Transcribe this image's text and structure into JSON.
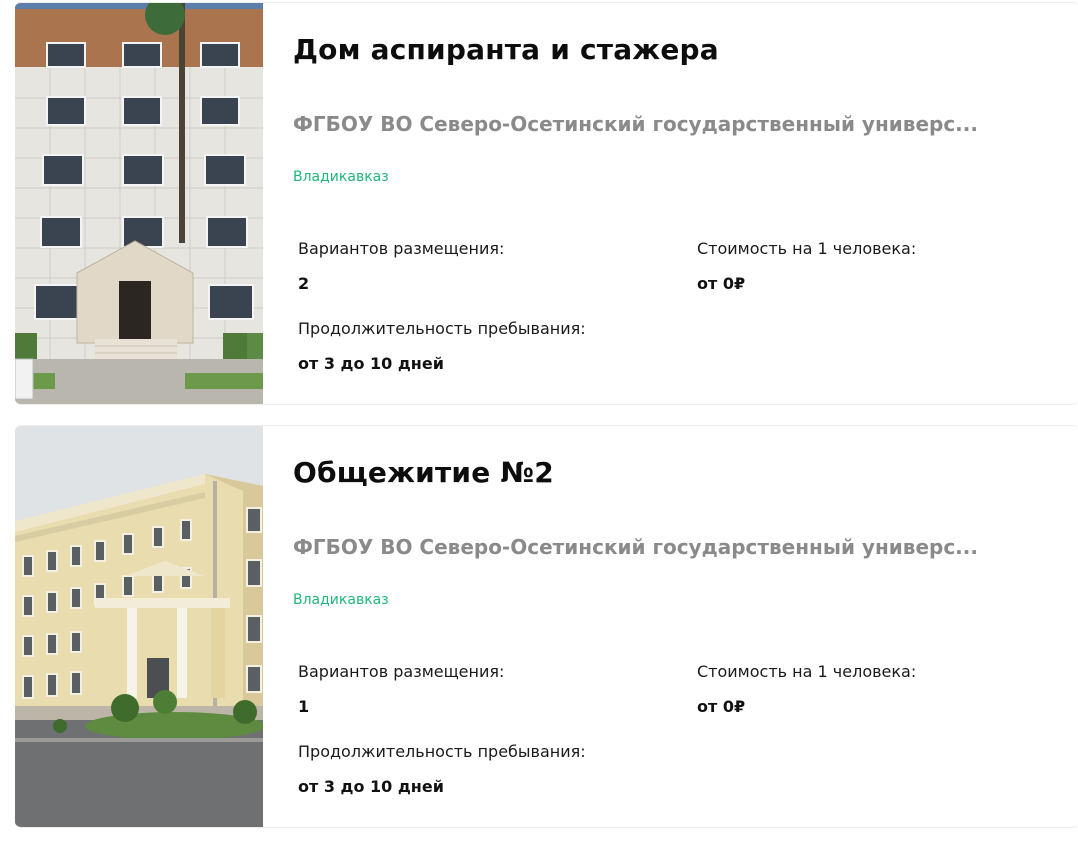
{
  "cards": [
    {
      "title": "Дом аспиранта и стажера",
      "organization": "ФГБОУ ВО Северо-Осетинский государственный универс...",
      "city": "Владикавказ",
      "placement_options_label": "Вариантов размещения:",
      "placement_options_value": "2",
      "cost_label": "Стоимость на 1 человека:",
      "cost_value": "от 0₽",
      "duration_label": "Продолжительность пребывания:",
      "duration_value": "от 3 до 10 дней",
      "photo": "building-photo"
    },
    {
      "title": "Общежитие №2",
      "organization": "ФГБОУ ВО Северо-Осетинский государственный универс...",
      "city": "Владикавказ",
      "placement_options_label": "Вариантов размещения:",
      "placement_options_value": "1",
      "cost_label": "Стоимость на 1 человека:",
      "cost_value": "от 0₽",
      "duration_label": "Продолжительность пребывания:",
      "duration_value": "от 3 до 10 дней",
      "photo": "building-photo"
    }
  ],
  "colors": {
    "city_accent": "#1fb77a",
    "organization_text": "#8a8a8a"
  }
}
